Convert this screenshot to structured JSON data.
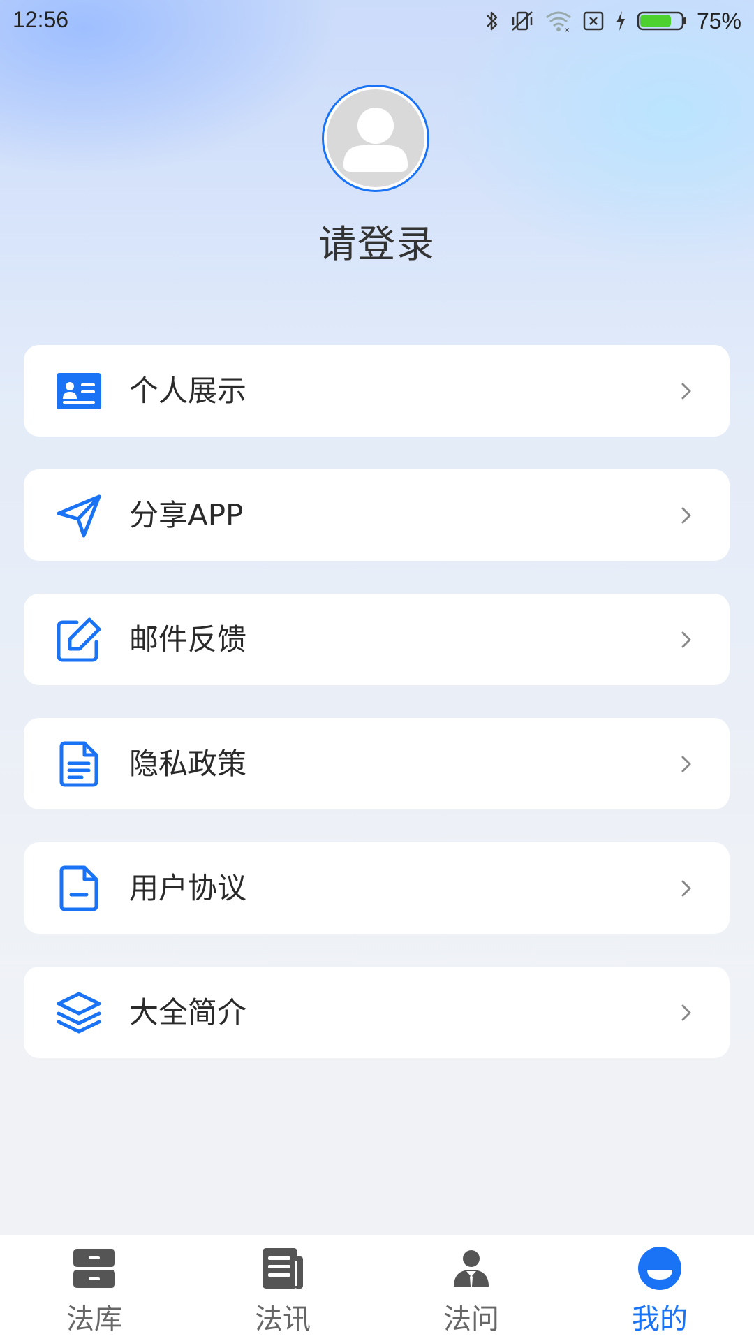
{
  "status_bar": {
    "time": "12:56",
    "battery_percent": "75%",
    "battery_level": 0.75,
    "icons": [
      "bluetooth-icon",
      "mute-vibrate-icon",
      "wifi-icon",
      "no-sim-icon",
      "charging-icon",
      "battery-icon"
    ]
  },
  "profile": {
    "login_prompt": "请登录"
  },
  "menu": {
    "items": [
      {
        "label": "个人展示",
        "icon": "id-card-icon"
      },
      {
        "label": "分享APP",
        "icon": "send-icon"
      },
      {
        "label": "邮件反馈",
        "icon": "edit-icon"
      },
      {
        "label": "隐私政策",
        "icon": "document-icon"
      },
      {
        "label": "用户协议",
        "icon": "file-icon"
      },
      {
        "label": "大全简介",
        "icon": "layers-icon"
      }
    ]
  },
  "bottom_nav": {
    "items": [
      {
        "label": "法库",
        "icon": "archive-icon",
        "active": false
      },
      {
        "label": "法讯",
        "icon": "news-icon",
        "active": false
      },
      {
        "label": "法问",
        "icon": "lawyer-icon",
        "active": false
      },
      {
        "label": "我的",
        "icon": "profile-icon",
        "active": true
      }
    ]
  },
  "colors": {
    "accent": "#1a73f5",
    "nav_inactive": "#666666",
    "text": "#2a2a2a",
    "card": "#ffffff"
  }
}
